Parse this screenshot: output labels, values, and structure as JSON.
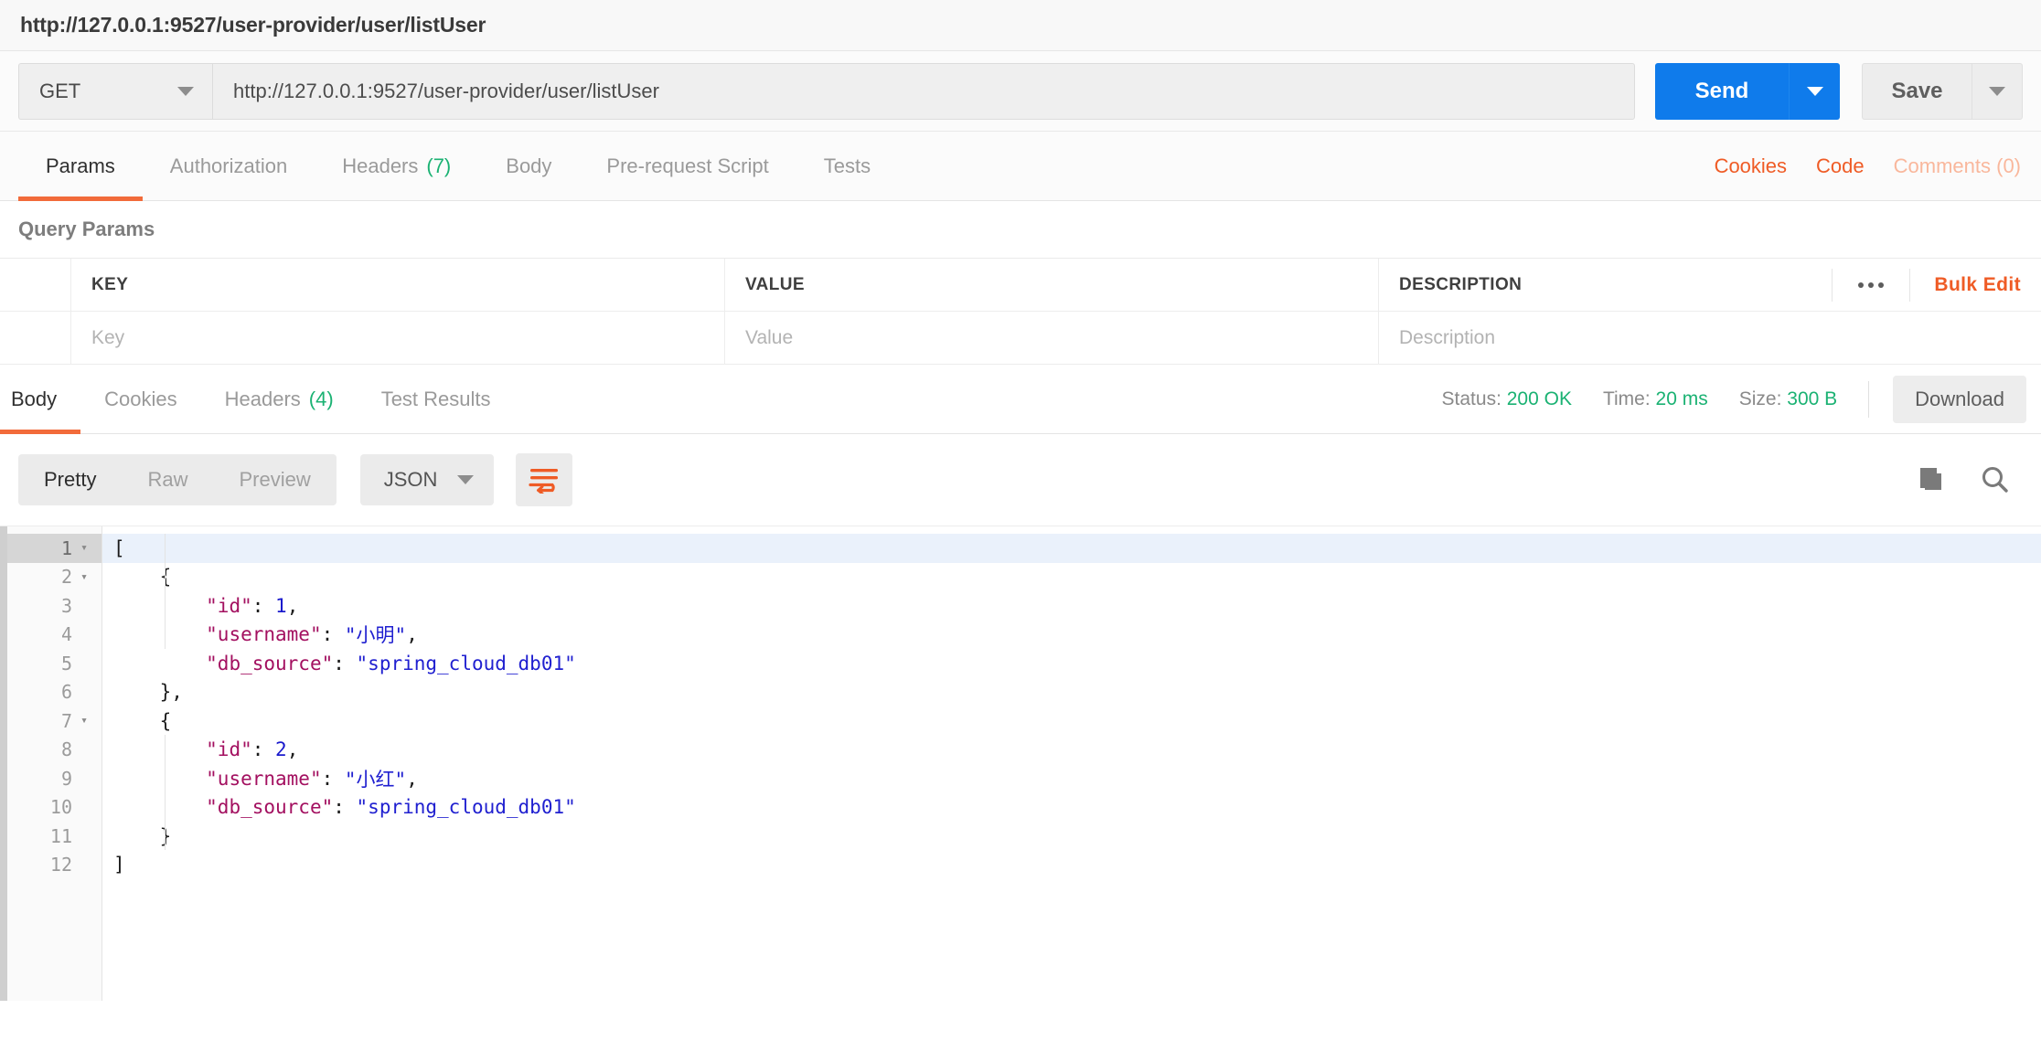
{
  "window": {
    "title": "http://127.0.0.1:9527/user-provider/user/listUser"
  },
  "request": {
    "method": "GET",
    "url": "http://127.0.0.1:9527/user-provider/user/listUser",
    "send_label": "Send",
    "save_label": "Save",
    "tabs": [
      {
        "label": "Params",
        "count": "",
        "active": true
      },
      {
        "label": "Authorization",
        "count": "",
        "active": false
      },
      {
        "label": "Headers",
        "count": "(7)",
        "active": false
      },
      {
        "label": "Body",
        "count": "",
        "active": false
      },
      {
        "label": "Pre-request Script",
        "count": "",
        "active": false
      },
      {
        "label": "Tests",
        "count": "",
        "active": false
      }
    ],
    "links": [
      {
        "label": "Cookies",
        "muted": false
      },
      {
        "label": "Code",
        "muted": false
      },
      {
        "label": "Comments (0)",
        "muted": true
      }
    ]
  },
  "query_params": {
    "section_title": "Query Params",
    "columns": [
      "KEY",
      "VALUE",
      "DESCRIPTION"
    ],
    "placeholder_row": {
      "key": "Key",
      "value": "Value",
      "description": "Description"
    },
    "bulk_edit_label": "Bulk Edit"
  },
  "response": {
    "tabs": [
      {
        "label": "Body",
        "count": "",
        "active": true
      },
      {
        "label": "Cookies",
        "count": "",
        "active": false
      },
      {
        "label": "Headers",
        "count": "(4)",
        "active": false
      },
      {
        "label": "Test Results",
        "count": "",
        "active": false
      }
    ],
    "meta": {
      "status_label": "Status:",
      "status_value": "200 OK",
      "time_label": "Time:",
      "time_value": "20 ms",
      "size_label": "Size:",
      "size_value": "300 B"
    },
    "download_label": "Download",
    "view_modes": [
      {
        "label": "Pretty",
        "active": true
      },
      {
        "label": "Raw",
        "active": false
      },
      {
        "label": "Preview",
        "active": false
      }
    ],
    "format": "JSON",
    "body_lines": [
      {
        "num": "1",
        "foldable": true,
        "highlight": true,
        "tokens": [
          {
            "t": "[",
            "c": "p"
          }
        ]
      },
      {
        "num": "2",
        "foldable": true,
        "highlight": false,
        "tokens": [
          {
            "t": "    {",
            "c": "p"
          }
        ]
      },
      {
        "num": "3",
        "foldable": false,
        "highlight": false,
        "tokens": [
          {
            "t": "        ",
            "c": "p"
          },
          {
            "t": "\"id\"",
            "c": "k"
          },
          {
            "t": ": ",
            "c": "p"
          },
          {
            "t": "1",
            "c": "n"
          },
          {
            "t": ",",
            "c": "p"
          }
        ]
      },
      {
        "num": "4",
        "foldable": false,
        "highlight": false,
        "tokens": [
          {
            "t": "        ",
            "c": "p"
          },
          {
            "t": "\"username\"",
            "c": "k"
          },
          {
            "t": ": ",
            "c": "p"
          },
          {
            "t": "\"小明\"",
            "c": "s"
          },
          {
            "t": ",",
            "c": "p"
          }
        ]
      },
      {
        "num": "5",
        "foldable": false,
        "highlight": false,
        "tokens": [
          {
            "t": "        ",
            "c": "p"
          },
          {
            "t": "\"db_source\"",
            "c": "k"
          },
          {
            "t": ": ",
            "c": "p"
          },
          {
            "t": "\"spring_cloud_db01\"",
            "c": "s"
          }
        ]
      },
      {
        "num": "6",
        "foldable": false,
        "highlight": false,
        "tokens": [
          {
            "t": "    },",
            "c": "p"
          }
        ]
      },
      {
        "num": "7",
        "foldable": true,
        "highlight": false,
        "tokens": [
          {
            "t": "    {",
            "c": "p"
          }
        ]
      },
      {
        "num": "8",
        "foldable": false,
        "highlight": false,
        "tokens": [
          {
            "t": "        ",
            "c": "p"
          },
          {
            "t": "\"id\"",
            "c": "k"
          },
          {
            "t": ": ",
            "c": "p"
          },
          {
            "t": "2",
            "c": "n"
          },
          {
            "t": ",",
            "c": "p"
          }
        ]
      },
      {
        "num": "9",
        "foldable": false,
        "highlight": false,
        "tokens": [
          {
            "t": "        ",
            "c": "p"
          },
          {
            "t": "\"username\"",
            "c": "k"
          },
          {
            "t": ": ",
            "c": "p"
          },
          {
            "t": "\"小红\"",
            "c": "s"
          },
          {
            "t": ",",
            "c": "p"
          }
        ]
      },
      {
        "num": "10",
        "foldable": false,
        "highlight": false,
        "tokens": [
          {
            "t": "        ",
            "c": "p"
          },
          {
            "t": "\"db_source\"",
            "c": "k"
          },
          {
            "t": ": ",
            "c": "p"
          },
          {
            "t": "\"spring_cloud_db01\"",
            "c": "s"
          }
        ]
      },
      {
        "num": "11",
        "foldable": false,
        "highlight": false,
        "tokens": [
          {
            "t": "    }",
            "c": "p"
          }
        ]
      },
      {
        "num": "12",
        "foldable": false,
        "highlight": false,
        "tokens": [
          {
            "t": "]",
            "c": "p"
          }
        ]
      }
    ]
  },
  "colors": {
    "accent_orange": "#f26b3a",
    "link_orange": "#ef5b25",
    "send_blue": "#0f7beb",
    "status_green": "#1bb273",
    "json_key": "#a31060",
    "json_string": "#2020d0"
  }
}
